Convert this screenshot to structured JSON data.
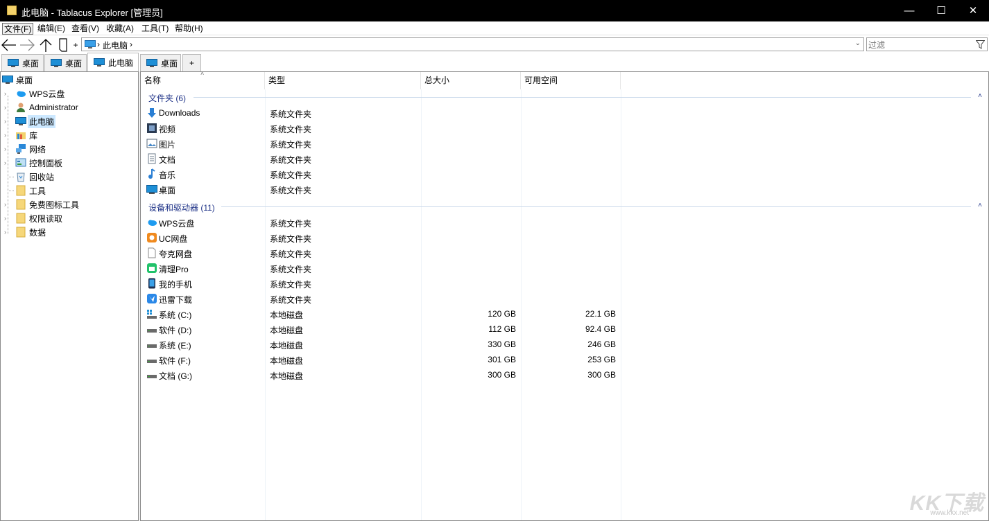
{
  "window": {
    "title": "此电脑 - Tablacus Explorer [管理员]",
    "minimize": "—",
    "maximize": "☐",
    "close": "✕"
  },
  "menu": [
    "文件(F)",
    "编辑(E)",
    "查看(V)",
    "收藏(A)",
    "工具(T)",
    "帮助(H)"
  ],
  "toolbar": {
    "back_icon": "back-arrow-icon",
    "forward_icon": "forward-arrow-icon",
    "up_icon": "up-arrow-icon",
    "bookmark_icon": "bookmark-icon",
    "plus": "+"
  },
  "address": {
    "sep1": "›",
    "location": "此电脑",
    "sep2": "›"
  },
  "filter": {
    "placeholder": "过滤"
  },
  "left_tabs": [
    "桌面",
    "桌面",
    "此电脑"
  ],
  "right_tabs": [
    "桌面"
  ],
  "add_tab": "+",
  "tree": {
    "root": "桌面",
    "items": [
      "WPS云盘",
      "Administrator",
      "此电脑",
      "库",
      "网络",
      "控制面板",
      "回收站",
      "工具",
      "免费图标工具",
      "权限读取",
      "数据"
    ]
  },
  "columns": [
    "名称",
    "类型",
    "总大小",
    "可用空间"
  ],
  "groups": [
    {
      "label": "文件夹 (6)",
      "rows": [
        {
          "name": "Downloads",
          "type": "系统文件夹",
          "size": "",
          "free": "",
          "icon": "download-icon"
        },
        {
          "name": "视频",
          "type": "系统文件夹",
          "size": "",
          "free": "",
          "icon": "video-icon"
        },
        {
          "name": "图片",
          "type": "系统文件夹",
          "size": "",
          "free": "",
          "icon": "picture-icon"
        },
        {
          "name": "文档",
          "type": "系统文件夹",
          "size": "",
          "free": "",
          "icon": "document-icon"
        },
        {
          "name": "音乐",
          "type": "系统文件夹",
          "size": "",
          "free": "",
          "icon": "music-icon"
        },
        {
          "name": "桌面",
          "type": "系统文件夹",
          "size": "",
          "free": "",
          "icon": "desktop-icon"
        }
      ]
    },
    {
      "label": "设备和驱动器 (11)",
      "rows": [
        {
          "name": "WPS云盘",
          "type": "系统文件夹",
          "size": "",
          "free": "",
          "icon": "cloud-icon"
        },
        {
          "name": "UC网盘",
          "type": "系统文件夹",
          "size": "",
          "free": "",
          "icon": "uc-icon"
        },
        {
          "name": "夸克网盘",
          "type": "系统文件夹",
          "size": "",
          "free": "",
          "icon": "blank-file-icon"
        },
        {
          "name": "清理Pro",
          "type": "系统文件夹",
          "size": "",
          "free": "",
          "icon": "cleaner-icon"
        },
        {
          "name": "我的手机",
          "type": "系统文件夹",
          "size": "",
          "free": "",
          "icon": "phone-icon"
        },
        {
          "name": "迅雷下载",
          "type": "系统文件夹",
          "size": "",
          "free": "",
          "icon": "thunder-icon"
        },
        {
          "name": "系统 (C:)",
          "type": "本地磁盘",
          "size": "120 GB",
          "free": "22.1 GB",
          "icon": "system-drive-icon"
        },
        {
          "name": "软件 (D:)",
          "type": "本地磁盘",
          "size": "112 GB",
          "free": "92.4 GB",
          "icon": "drive-icon"
        },
        {
          "name": "系统 (E:)",
          "type": "本地磁盘",
          "size": "330 GB",
          "free": "246 GB",
          "icon": "drive-icon"
        },
        {
          "name": "软件 (F:)",
          "type": "本地磁盘",
          "size": "301 GB",
          "free": "253 GB",
          "icon": "drive-icon"
        },
        {
          "name": "文档 (G:)",
          "type": "本地磁盘",
          "size": "300 GB",
          "free": "300 GB",
          "icon": "drive-icon"
        }
      ]
    }
  ],
  "watermark": {
    "big": "KK下载",
    "small": "www.kkx.net"
  },
  "colors": {
    "accent": "#1e3287",
    "selection": "#cce8ff",
    "folder": "#f3d26b",
    "monitor": "#1e8fd6"
  }
}
